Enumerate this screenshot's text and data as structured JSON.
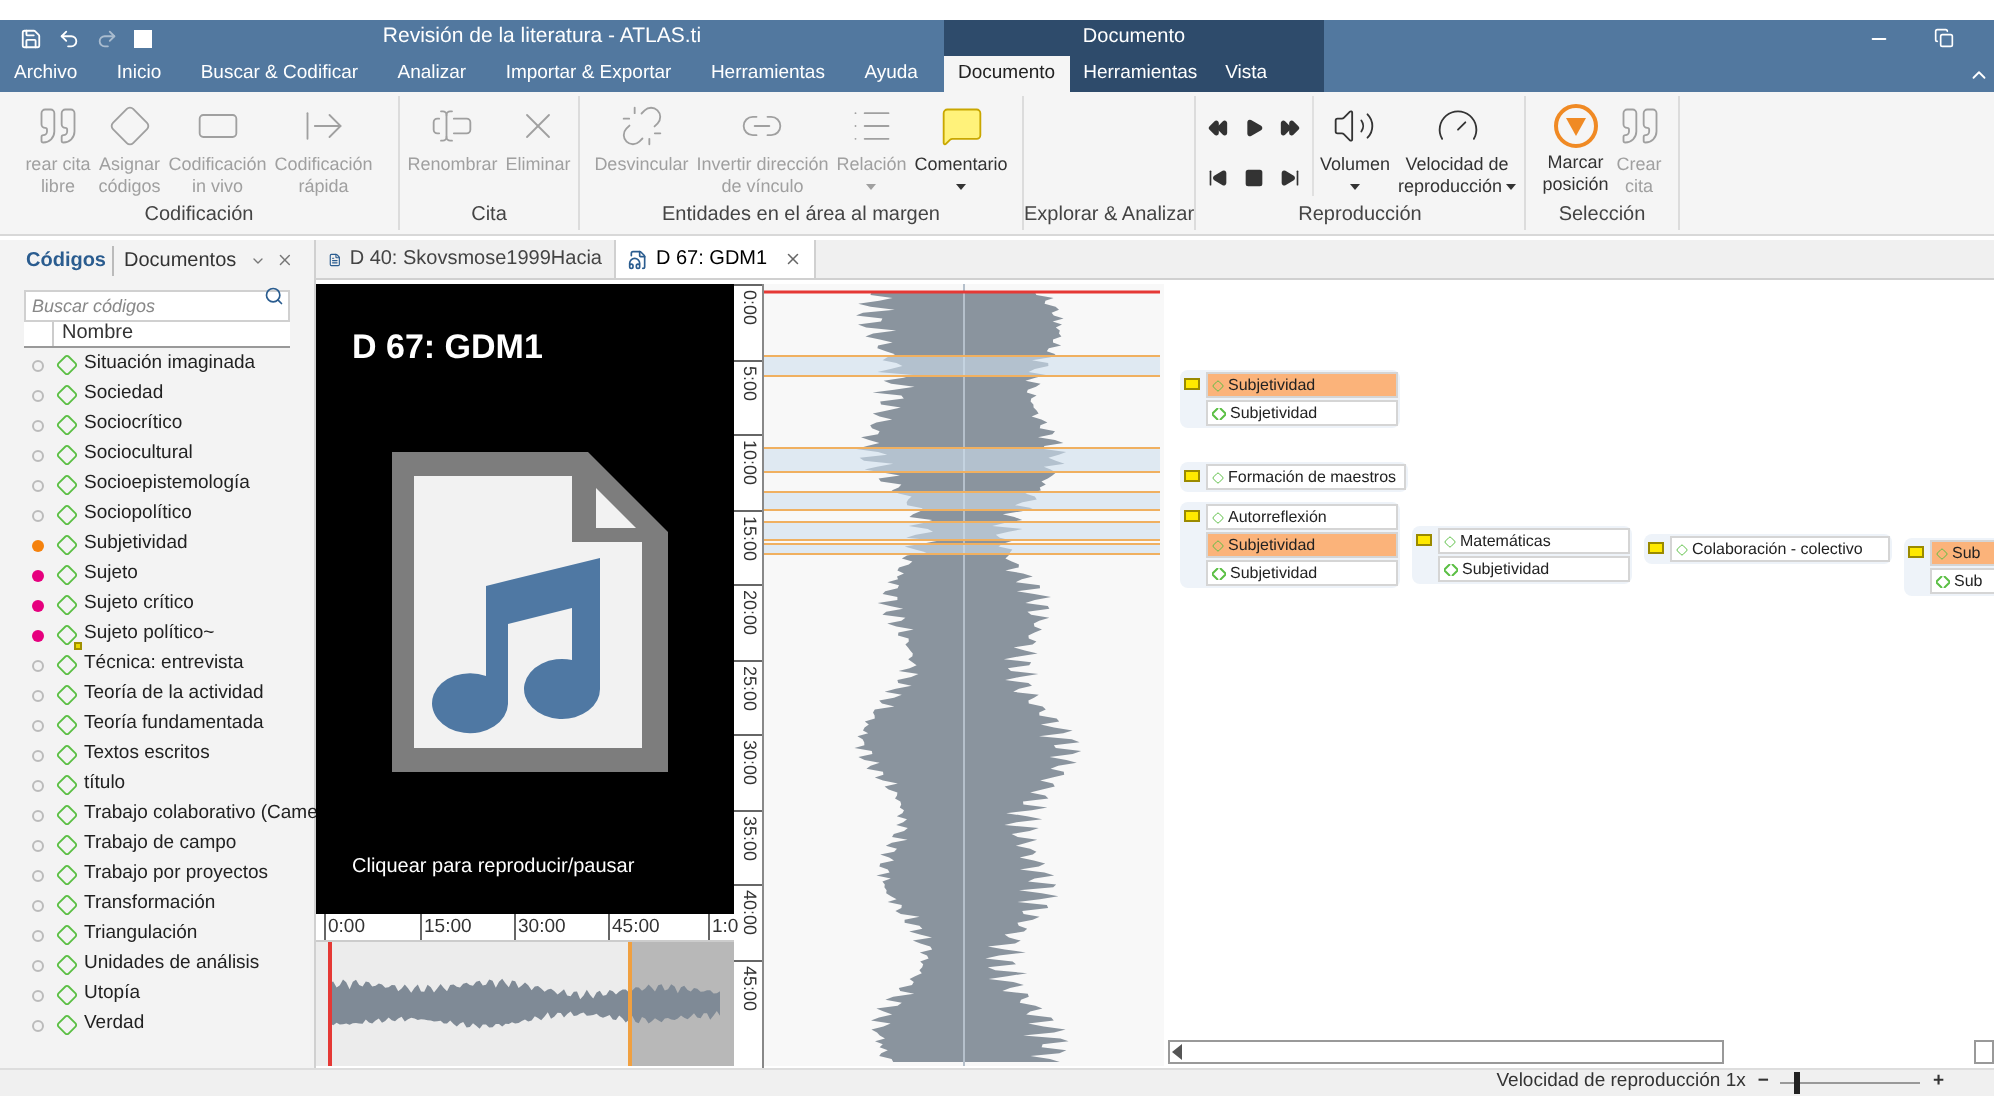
{
  "window": {
    "title": "Revisión de la literatura - ATLAS.ti",
    "context_group": "Documento"
  },
  "ribbon_tabs": [
    {
      "label": "Archivo",
      "selected": false,
      "kind": "main"
    },
    {
      "label": "Inicio",
      "selected": false,
      "kind": "main"
    },
    {
      "label": "Buscar & Codificar",
      "selected": false,
      "kind": "main"
    },
    {
      "label": "Analizar",
      "selected": false,
      "kind": "main"
    },
    {
      "label": "Importar & Exportar",
      "selected": false,
      "kind": "main"
    },
    {
      "label": "Herramientas",
      "selected": false,
      "kind": "main"
    },
    {
      "label": "Ayuda",
      "selected": false,
      "kind": "main"
    },
    {
      "label": "Documento",
      "selected": true,
      "kind": "context"
    },
    {
      "label": "Herramientas",
      "selected": false,
      "kind": "context"
    },
    {
      "label": "Vista",
      "selected": false,
      "kind": "context"
    }
  ],
  "ribbon_groups": [
    {
      "label": "Codificación",
      "buttons": [
        {
          "kind": "large",
          "lines": [
            "rear cita",
            "libre"
          ],
          "disabled": true,
          "dropdown": false
        },
        {
          "kind": "large",
          "lines": [
            "Asignar",
            "códigos"
          ],
          "disabled": true,
          "dropdown": false
        },
        {
          "kind": "large",
          "lines": [
            "Codificación",
            "in vivo"
          ],
          "disabled": true,
          "dropdown": false
        },
        {
          "kind": "large",
          "lines": [
            "Codificación",
            "rápida"
          ],
          "disabled": true,
          "dropdown": false
        }
      ]
    },
    {
      "label": "Cita",
      "buttons": [
        {
          "kind": "large",
          "lines": [
            "Renombrar"
          ],
          "disabled": true,
          "dropdown": false
        },
        {
          "kind": "large",
          "lines": [
            "Eliminar"
          ],
          "disabled": true,
          "dropdown": false
        }
      ]
    },
    {
      "label": "Entidades en el área al margen",
      "buttons": [
        {
          "kind": "large",
          "lines": [
            "Desvincular"
          ],
          "disabled": true,
          "dropdown": false
        },
        {
          "kind": "large",
          "lines": [
            "Invertir dirección",
            "de vínculo"
          ],
          "disabled": true,
          "dropdown": false
        },
        {
          "kind": "large",
          "lines": [
            "Relación"
          ],
          "disabled": true,
          "dropdown": true
        },
        {
          "kind": "large",
          "lines": [
            "Comentario"
          ],
          "disabled": false,
          "dropdown": true
        }
      ]
    },
    {
      "label": "Explorar & Analizar"
    },
    {
      "label": "Reproducción",
      "buttons": [
        {
          "kind": "transport",
          "disabled": false
        },
        {
          "kind": "transport",
          "disabled": false
        },
        {
          "kind": "transport",
          "disabled": false
        },
        {
          "kind": "transport",
          "disabled": false
        },
        {
          "kind": "transport",
          "disabled": false
        },
        {
          "kind": "transport",
          "disabled": false
        },
        {
          "kind": "large",
          "lines": [
            "Volumen"
          ],
          "disabled": false,
          "dropdown": true
        },
        {
          "kind": "large",
          "lines": [
            "Velocidad de",
            "reproducción"
          ],
          "disabled": false,
          "dropdown": true
        }
      ]
    },
    {
      "label": "Selección",
      "buttons": [
        {
          "kind": "large",
          "lines": [
            "Marcar",
            "posición"
          ],
          "disabled": false,
          "dropdown": false
        },
        {
          "kind": "large",
          "lines": [
            "Crear",
            "cita"
          ],
          "disabled": true,
          "dropdown": false
        }
      ]
    }
  ],
  "codes_panel": {
    "tabs": [
      {
        "label": "Códigos",
        "selected": true
      },
      {
        "label": "Documentos",
        "selected": false
      }
    ],
    "search": {
      "placeholder": "Buscar códigos"
    },
    "column": "Nombre",
    "codes": [
      {
        "name": "Situación imaginada",
        "comment": false
      },
      {
        "name": "Sociedad",
        "comment": false
      },
      {
        "name": "Sociocrítico",
        "comment": false
      },
      {
        "name": "Sociocultural",
        "comment": false
      },
      {
        "name": "Socioepistemología",
        "comment": false
      },
      {
        "name": "Sociopolítico",
        "comment": false
      },
      {
        "name": "Subjetividad",
        "color": "#f5820d",
        "comment": false
      },
      {
        "name": "Sujeto",
        "color": "#e6007e",
        "comment": false
      },
      {
        "name": "Sujeto crítico",
        "color": "#e6007e",
        "comment": false
      },
      {
        "name": "Sujeto político~",
        "color": "#e6007e",
        "comment": true
      },
      {
        "name": "Técnica: entrevista",
        "comment": false
      },
      {
        "name": "Teoría de la actividad",
        "comment": false
      },
      {
        "name": "Teoría fundamentada",
        "comment": false
      },
      {
        "name": "Textos escritos",
        "comment": false
      },
      {
        "name": "título",
        "comment": false
      },
      {
        "name": "Trabajo colaborativo (Came",
        "comment": false
      },
      {
        "name": "Trabajo de campo",
        "comment": false
      },
      {
        "name": "Trabajo por proyectos",
        "comment": false
      },
      {
        "name": "Transformación",
        "comment": false
      },
      {
        "name": "Triangulación",
        "comment": false
      },
      {
        "name": "Unidades de análisis",
        "comment": false
      },
      {
        "name": "Utopía",
        "comment": false
      },
      {
        "name": "Verdad",
        "comment": false
      }
    ]
  },
  "doc_tabs": [
    {
      "label": "D 40: Skovsmose1999Hacia",
      "selected": false
    },
    {
      "label": "D 67: GDM1",
      "selected": true
    }
  ],
  "player": {
    "title": "D 67: GDM1",
    "caption": "Cliquear para reproducir/pausar",
    "timeline": [
      "0:00",
      "15:00",
      "30:00",
      "45:00",
      "1:0"
    ]
  },
  "ruler": [
    "0:00",
    "5:00",
    "10:00",
    "15:00",
    "20:00",
    "25:00",
    "30:00",
    "35:00",
    "40:00",
    "45:00"
  ],
  "margin_groups": [
    {
      "items": [
        {
          "label": "Subjetividad",
          "kind": "code",
          "selected": true
        },
        {
          "label": "Subjetividad",
          "kind": "link",
          "selected": false
        }
      ]
    },
    {
      "items": [
        {
          "label": "Formación de maestros",
          "kind": "code",
          "selected": false
        }
      ]
    },
    {
      "items": [
        {
          "label": "Autorreflexión",
          "kind": "code",
          "selected": false
        },
        {
          "label": "Subjetividad",
          "kind": "code",
          "selected": true
        },
        {
          "label": "Subjetividad",
          "kind": "link",
          "selected": false
        }
      ]
    },
    {
      "items": [
        {
          "label": "Matemáticas",
          "kind": "code",
          "selected": false
        },
        {
          "label": "Subjetividad",
          "kind": "link",
          "selected": false
        }
      ]
    },
    {
      "items": [
        {
          "label": "Colaboración - colectivo",
          "kind": "code",
          "selected": false
        }
      ]
    },
    {
      "items": [
        {
          "label": "Sub",
          "kind": "code",
          "selected": true
        },
        {
          "label": "Sub",
          "kind": "link",
          "selected": false
        }
      ]
    }
  ],
  "status_bar": {
    "speed_label": "Velocidad de reproducción 1x",
    "minus": "−",
    "plus": "+",
    "speed": {
      "level": 0.1
    }
  }
}
